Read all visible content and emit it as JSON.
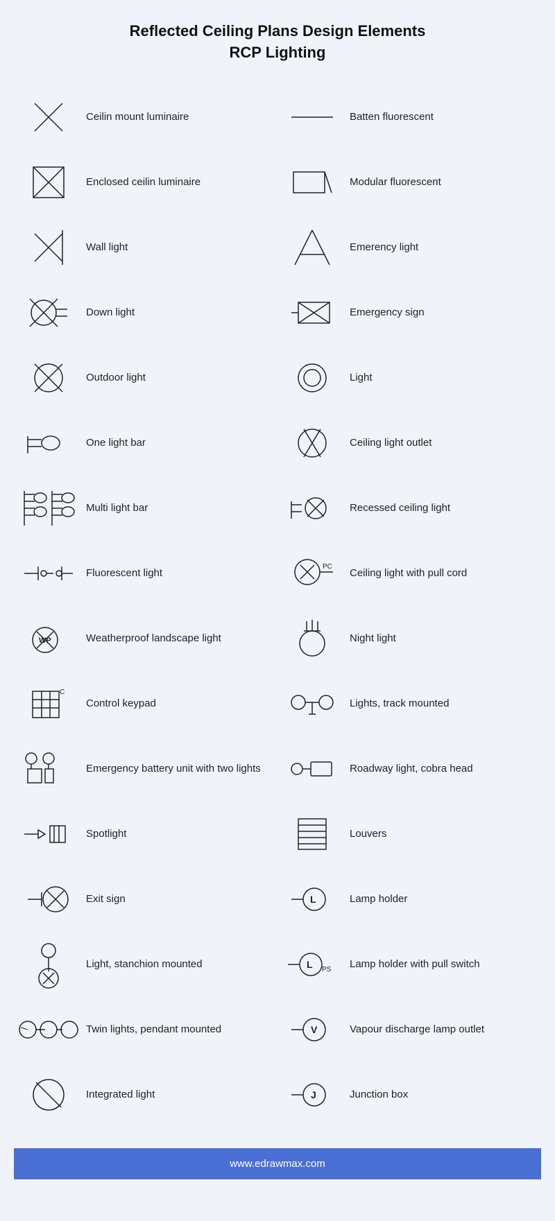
{
  "header": {
    "line1": "Reflected Ceiling Plans Design Elements",
    "line2": "RCP Lighting"
  },
  "items": [
    {
      "id": "ceiling-mount-luminaire",
      "label": "Ceilin mount luminaire",
      "symbol": "ceiling-mount"
    },
    {
      "id": "batten-fluorescent",
      "label": "Batten fluorescent",
      "symbol": "batten"
    },
    {
      "id": "enclosed-ceiling-luminaire",
      "label": "Enclosed ceilin luminaire",
      "symbol": "enclosed-ceiling"
    },
    {
      "id": "modular-fluorescent",
      "label": "Modular fluorescent",
      "symbol": "modular-fluorescent"
    },
    {
      "id": "wall-light",
      "label": "Wall light",
      "symbol": "wall-light"
    },
    {
      "id": "emergency-light",
      "label": "Emerency light",
      "symbol": "emergency-light"
    },
    {
      "id": "down-light",
      "label": "Down light",
      "symbol": "down-light"
    },
    {
      "id": "emergency-sign",
      "label": "Emergency sign",
      "symbol": "emergency-sign"
    },
    {
      "id": "outdoor-light",
      "label": "Outdoor light",
      "symbol": "outdoor-light"
    },
    {
      "id": "light",
      "label": "Light",
      "symbol": "light"
    },
    {
      "id": "one-light-bar",
      "label": "One light bar",
      "symbol": "one-light-bar"
    },
    {
      "id": "ceiling-light-outlet",
      "label": "Ceiling light outlet",
      "symbol": "ceiling-light-outlet"
    },
    {
      "id": "multi-light-bar",
      "label": "Multi light bar",
      "symbol": "multi-light-bar"
    },
    {
      "id": "recessed-ceiling-light",
      "label": "Recessed ceiling light",
      "symbol": "recessed-ceiling-light"
    },
    {
      "id": "fluorescent-light",
      "label": "Fluorescent light",
      "symbol": "fluorescent-light"
    },
    {
      "id": "ceiling-light-pull-cord",
      "label": "Ceiling light with pull cord",
      "symbol": "ceiling-light-pull-cord"
    },
    {
      "id": "weatherproof-landscape",
      "label": "Weatherproof landscape light",
      "symbol": "weatherproof"
    },
    {
      "id": "night-light",
      "label": "Night light",
      "symbol": "night-light"
    },
    {
      "id": "control-keypad",
      "label": "Control keypad",
      "symbol": "control-keypad"
    },
    {
      "id": "lights-track-mounted",
      "label": "Lights, track mounted",
      "symbol": "lights-track"
    },
    {
      "id": "emergency-battery",
      "label": "Emergency battery unit with two lights",
      "symbol": "emergency-battery"
    },
    {
      "id": "roadway-light",
      "label": "Roadway light, cobra head",
      "symbol": "roadway-light"
    },
    {
      "id": "spotlight",
      "label": "Spotlight",
      "symbol": "spotlight"
    },
    {
      "id": "louvers",
      "label": "Louvers",
      "symbol": "louvers"
    },
    {
      "id": "exit-sign",
      "label": "Exit sign",
      "symbol": "exit-sign"
    },
    {
      "id": "lamp-holder",
      "label": "Lamp holder",
      "symbol": "lamp-holder"
    },
    {
      "id": "light-stanchion",
      "label": "Light, stanchion mounted",
      "symbol": "light-stanchion"
    },
    {
      "id": "lamp-holder-pull",
      "label": "Lamp holder with pull switch",
      "symbol": "lamp-holder-pull"
    },
    {
      "id": "twin-lights",
      "label": "Twin lights, pendant mounted",
      "symbol": "twin-lights"
    },
    {
      "id": "vapour-discharge",
      "label": "Vapour discharge lamp outlet",
      "symbol": "vapour-discharge"
    },
    {
      "id": "integrated-light",
      "label": "Integrated light",
      "symbol": "integrated-light"
    },
    {
      "id": "junction-box",
      "label": "Junction box",
      "symbol": "junction-box"
    }
  ],
  "footer": {
    "url": "www.edrawmax.com"
  }
}
